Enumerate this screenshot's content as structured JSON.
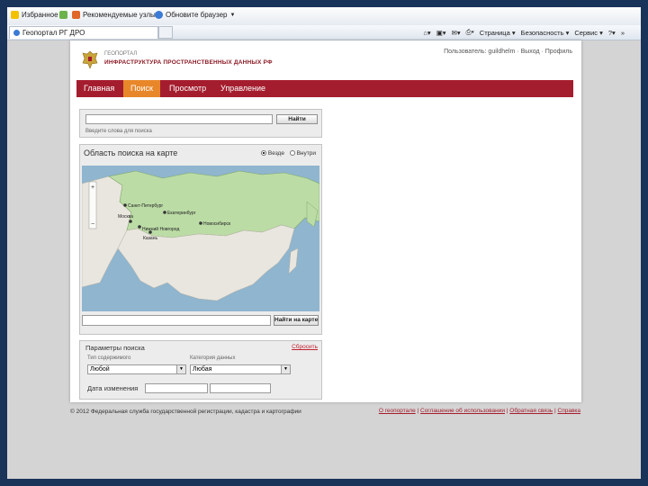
{
  "favorites_bar": {
    "favorites": "Избранное",
    "suggested_sites": "Рекомендуемые узлы",
    "update_browser": "Обновите браузер"
  },
  "command_bar": {
    "tab_title": "Геопортал РГ ДРО",
    "page": "Страница",
    "safety": "Безопасность",
    "tools": "Сервис",
    "chevron": "»"
  },
  "header": {
    "logo_top": "ГЕОПОРТАЛ",
    "logo_name": "ИНФРАСТРУКТУРА ПРОСТРАНСТВЕННЫХ ДАННЫХ РФ",
    "user_links": "Пользователь: guildhelm · Выход · Профиль"
  },
  "nav": {
    "items": [
      {
        "label": "Главная"
      },
      {
        "label": "Поиск"
      },
      {
        "label": "Просмотр"
      },
      {
        "label": "Управление"
      }
    ],
    "active_index": 1
  },
  "search": {
    "query_value": "",
    "find_button": "Найти",
    "hint": "Введите слова для поиска"
  },
  "map_area": {
    "title": "Область поиска на карте",
    "radio_everywhere": "Везде",
    "radio_inside": "Внутри",
    "cities": [
      "Санкт-Петербург",
      "Москва",
      "Екатеринбург",
      "Новосибирск",
      "Нижний Новгород",
      "Казань"
    ],
    "location_value": "",
    "find_on_map_button": "Найти на карте"
  },
  "params": {
    "title": "Параметры поиска",
    "reset_link": "Сбросить",
    "content_type_label": "Тип содержимого",
    "content_type_value": "Любой",
    "category_label": "Категория данных",
    "category_value": "Любая",
    "date_label": "Дата изменения"
  },
  "footer": {
    "copyright": "© 2012 Федеральная служба государственной регистрации, кадастра и картографии",
    "links": [
      "О геопортале",
      "Соглашение об использовании",
      "Обратная связь",
      "Справка"
    ]
  },
  "colors": {
    "brand": "#a41d2e",
    "active_tab": "#e8872a",
    "sea": "#8fb5cf",
    "russia": "#bcdca6"
  }
}
